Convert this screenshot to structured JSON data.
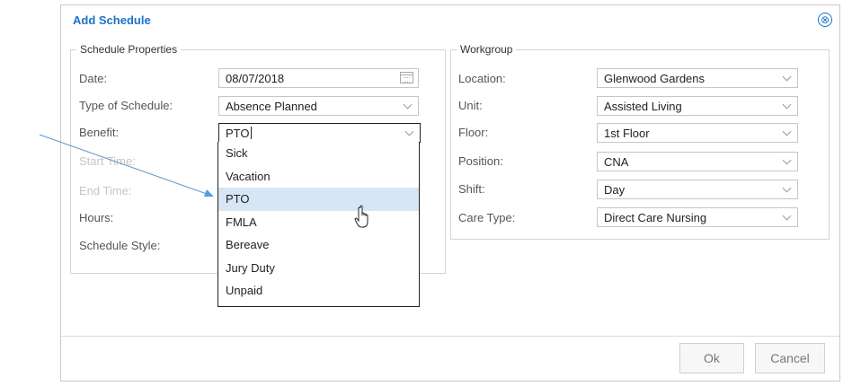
{
  "dialog": {
    "title": "Add Schedule",
    "close_icon": "⊗"
  },
  "properties": {
    "legend": "Schedule Properties",
    "date_label": "Date:",
    "date_value": "08/07/2018",
    "type_label": "Type of Schedule:",
    "type_value": "Absence Planned",
    "benefit_label": "Benefit:",
    "benefit_value": "PTO",
    "start_label": "Start Time:",
    "end_label": "End Time:",
    "hours_label": "Hours:",
    "style_label": "Schedule Style:"
  },
  "benefit_options": [
    "Sick",
    "Vacation",
    "PTO",
    "FMLA",
    "Bereave",
    "Jury Duty",
    "Unpaid"
  ],
  "hovered_option": "PTO",
  "workgroup": {
    "legend": "Workgroup",
    "location_label": "Location:",
    "location_value": "Glenwood Gardens",
    "unit_label": "Unit:",
    "unit_value": "Assisted Living",
    "floor_label": "Floor:",
    "floor_value": "1st Floor",
    "position_label": "Position:",
    "position_value": "CNA",
    "shift_label": "Shift:",
    "shift_value": "Day",
    "care_label": "Care Type:",
    "care_value": "Direct Care Nursing"
  },
  "footer": {
    "ok_label": "Ok",
    "cancel_label": "Cancel"
  },
  "colors": {
    "accent": "#1a73c7",
    "hover": "#d7e6f5",
    "arrow": "#5b9bd5"
  }
}
